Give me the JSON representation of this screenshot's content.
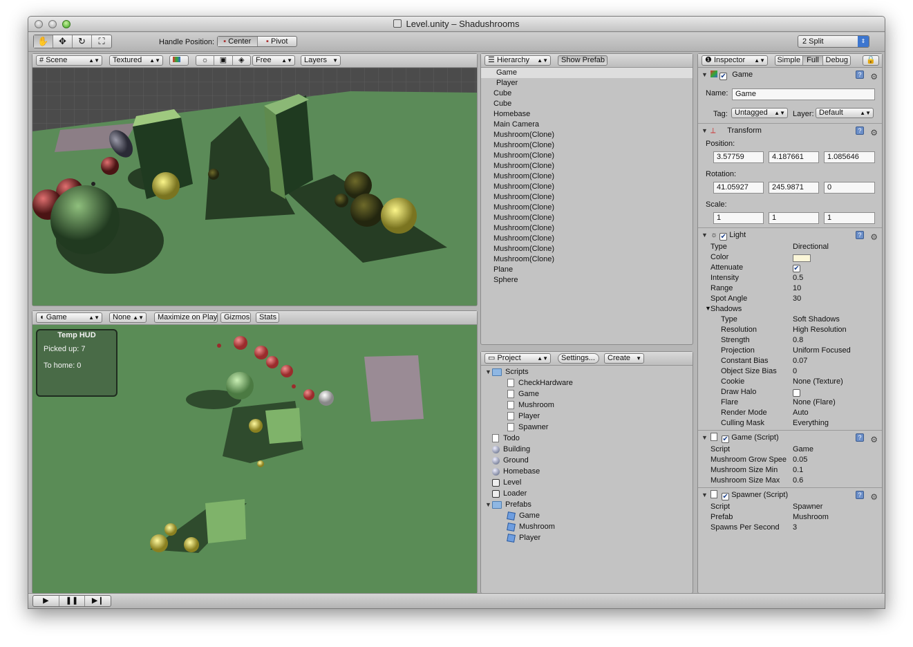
{
  "window": {
    "title": "Level.unity – Shadushrooms"
  },
  "toolbar": {
    "handle_position_label": "Handle Position:",
    "center_label": "Center",
    "pivot_label": "Pivot",
    "layout_value": "2 Split"
  },
  "scene": {
    "mode": "Scene",
    "render": "Textured",
    "camera": "Free",
    "layers": "Layers"
  },
  "game": {
    "mode": "Game",
    "aspect": "None",
    "maximize_label": "Maximize on Play",
    "gizmos_label": "Gizmos",
    "stats_label": "Stats",
    "hud": {
      "title": "Temp HUD",
      "picked": "Picked up: 7",
      "home": "To home: 0"
    }
  },
  "hierarchy": {
    "tab": "Hierarchy",
    "show_prefab": "Show Prefab",
    "items": [
      "Game",
      "Player",
      "Cube",
      "Cube",
      "Homebase",
      "Main Camera",
      "Mushroom(Clone)",
      "Mushroom(Clone)",
      "Mushroom(Clone)",
      "Mushroom(Clone)",
      "Mushroom(Clone)",
      "Mushroom(Clone)",
      "Mushroom(Clone)",
      "Mushroom(Clone)",
      "Mushroom(Clone)",
      "Mushroom(Clone)",
      "Mushroom(Clone)",
      "Mushroom(Clone)",
      "Mushroom(Clone)",
      "Plane",
      "Sphere"
    ]
  },
  "project": {
    "tab": "Project",
    "settings": "Settings...",
    "create": "Create",
    "items": [
      {
        "label": "Scripts",
        "icon": "folder",
        "indent": 0,
        "tri": true
      },
      {
        "label": "CheckHardware",
        "icon": "script",
        "indent": 1
      },
      {
        "label": "Game",
        "icon": "script",
        "indent": 1
      },
      {
        "label": "Mushroom",
        "icon": "script",
        "indent": 1
      },
      {
        "label": "Player",
        "icon": "script",
        "indent": 1
      },
      {
        "label": "Spawner",
        "icon": "script",
        "indent": 1
      },
      {
        "label": "Todo",
        "icon": "script",
        "indent": 0
      },
      {
        "label": "Building",
        "icon": "sphere",
        "indent": 0
      },
      {
        "label": "Ground",
        "icon": "sphere",
        "indent": 0
      },
      {
        "label": "Homebase",
        "icon": "sphere",
        "indent": 0
      },
      {
        "label": "Level",
        "icon": "unity",
        "indent": 0
      },
      {
        "label": "Loader",
        "icon": "unity",
        "indent": 0
      },
      {
        "label": "Prefabs",
        "icon": "folder",
        "indent": 0,
        "tri": true
      },
      {
        "label": "Game",
        "icon": "cube",
        "indent": 1
      },
      {
        "label": "Mushroom",
        "icon": "cube",
        "indent": 1
      },
      {
        "label": "Player",
        "icon": "cube",
        "indent": 1
      }
    ]
  },
  "inspector": {
    "tab": "Inspector",
    "simple": "Simple",
    "full": "Full",
    "debug": "Debug",
    "object_name": "Game",
    "name_label": "Name:",
    "name_value": "Game",
    "tag_label": "Tag:",
    "tag_value": "Untagged",
    "layer_label": "Layer:",
    "layer_value": "Default",
    "transform": {
      "title": "Transform",
      "position_label": "Position:",
      "position": [
        "3.57759",
        "4.187661",
        "1.085646"
      ],
      "rotation_label": "Rotation:",
      "rotation": [
        "41.05927",
        "245.9871",
        "0"
      ],
      "scale_label": "Scale:",
      "scale": [
        "1",
        "1",
        "1"
      ]
    },
    "light": {
      "title": "Light",
      "props": [
        {
          "k": "Type",
          "v": "Directional"
        },
        {
          "k": "Color",
          "v": ""
        },
        {
          "k": "Attenuate",
          "v": "✔"
        },
        {
          "k": "Intensity",
          "v": "0.5"
        },
        {
          "k": "Range",
          "v": "10"
        },
        {
          "k": "Spot Angle",
          "v": "30"
        },
        {
          "k": "Shadows",
          "v": ""
        },
        {
          "k": "Type",
          "v": "Soft Shadows"
        },
        {
          "k": "Resolution",
          "v": "High Resolution"
        },
        {
          "k": "Strength",
          "v": "0.8"
        },
        {
          "k": "Projection",
          "v": "Uniform Focused"
        },
        {
          "k": "Constant Bias",
          "v": "0.07"
        },
        {
          "k": "Object Size Bias",
          "v": "0"
        },
        {
          "k": "Cookie",
          "v": "None (Texture)"
        },
        {
          "k": "Draw Halo",
          "v": ""
        },
        {
          "k": "Flare",
          "v": "None (Flare)"
        },
        {
          "k": "Render Mode",
          "v": "Auto"
        },
        {
          "k": "Culling Mask",
          "v": "Everything"
        }
      ]
    },
    "game_script": {
      "title": "Game (Script)",
      "props": [
        {
          "k": "Script",
          "v": "Game"
        },
        {
          "k": "Mushroom Grow Spee",
          "v": "0.05"
        },
        {
          "k": "Mushroom Size Min",
          "v": "0.1"
        },
        {
          "k": "Mushroom Size Max",
          "v": "0.6"
        }
      ]
    },
    "spawner_script": {
      "title": "Spawner (Script)",
      "props": [
        {
          "k": "Script",
          "v": "Spawner"
        },
        {
          "k": "Prefab",
          "v": "Mushroom"
        },
        {
          "k": "Spawns Per Second",
          "v": "3"
        }
      ]
    }
  },
  "colors": {
    "ground": "#5a8c56",
    "cube": "#7fb36a",
    "mushroom_red": "#c84a4a",
    "mushroom_yellow": "#e8e040",
    "sky": "#474747"
  }
}
